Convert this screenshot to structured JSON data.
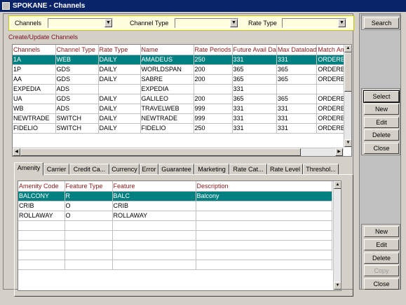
{
  "window": {
    "title": "SPOKANE - Channels"
  },
  "filters": {
    "channels_label": "Channels",
    "channel_type_label": "Channel Type",
    "rate_type_label": "Rate Type",
    "channels_value": "",
    "channel_type_value": "",
    "rate_type_value": ""
  },
  "channels_group": {
    "title": "Create/Update Channels",
    "columns": [
      "Channels",
      "Channel Type",
      "Rate Type",
      "Name",
      "Rate Periods",
      "Future Avail Da",
      "Max Dataload",
      "Match Am"
    ],
    "rows": [
      [
        "1A",
        "WEB",
        "DAILY",
        "AMADEUS",
        "250",
        "331",
        "331",
        "ORDERBY"
      ],
      [
        "1P",
        "GDS",
        "DAILY",
        "WORLDSPAN",
        "200",
        "365",
        "365",
        "ORDERBY"
      ],
      [
        "AA",
        "GDS",
        "DAILY",
        "SABRE",
        "200",
        "365",
        "365",
        "ORDERBY"
      ],
      [
        "EXPEDIA",
        "ADS",
        "",
        "EXPEDIA",
        "",
        "331",
        "",
        ""
      ],
      [
        "UA",
        "GDS",
        "DAILY",
        "GALILEO",
        "200",
        "365",
        "365",
        "ORDERBY"
      ],
      [
        "WB",
        "ADS",
        "DAILY",
        "TRAVELWEB",
        "999",
        "331",
        "331",
        "ORDERBY"
      ],
      [
        "NEWTRADE",
        "SWITCH",
        "DAILY",
        "NEWTRADE",
        "999",
        "331",
        "331",
        "ORDERBY"
      ],
      [
        "FIDELIO",
        "SWITCH",
        "DAILY",
        "FIDELIO",
        "250",
        "331",
        "331",
        "ORDERBY"
      ]
    ],
    "selected_row": 0
  },
  "tabs": [
    "Amenity",
    "Carrier",
    "Credit Ca...",
    "Currency",
    "Error",
    "Guarantee",
    "Marketing",
    "Rate Cat...",
    "Rate Level",
    "Threshol..."
  ],
  "active_tab": 0,
  "amenity": {
    "columns": [
      "Amenity Code",
      "Feature Type",
      "Feature",
      "Description"
    ],
    "rows": [
      [
        "BALCONY",
        "R",
        "BALC",
        "Balcony"
      ],
      [
        "CRIB",
        "O",
        "CRIB",
        ""
      ],
      [
        "ROLLAWAY",
        "O",
        "ROLLAWAY",
        ""
      ],
      [
        "",
        "",
        "",
        ""
      ],
      [
        "",
        "",
        "",
        ""
      ],
      [
        "",
        "",
        "",
        ""
      ],
      [
        "",
        "",
        "",
        ""
      ],
      [
        "",
        "",
        "",
        ""
      ]
    ],
    "selected_row": 0
  },
  "buttons_top": {
    "search": "Search"
  },
  "buttons_channels": {
    "select": "Select",
    "new": "New",
    "edit": "Edit",
    "delete": "Delete",
    "close": "Close"
  },
  "buttons_amenity": {
    "new": "New",
    "edit": "Edit",
    "delete": "Delete",
    "copy": "Copy",
    "close": "Close"
  },
  "colors": {
    "selection": "#008080",
    "titlebar": "#0a246a",
    "filter_bg": "#ffffe0",
    "header_text": "#8b1a1a"
  }
}
